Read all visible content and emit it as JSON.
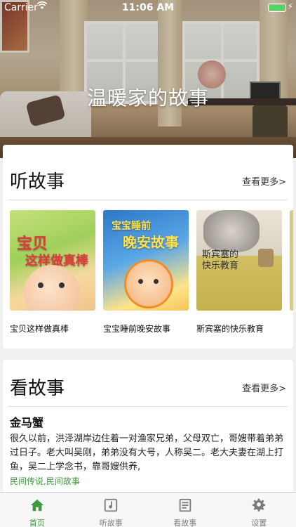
{
  "status_bar": {
    "carrier": "Carrier",
    "time": "11:06 AM"
  },
  "hero": {
    "title": "温暖家的故事"
  },
  "listen_section": {
    "title": "听故事",
    "more_label": "查看更多>",
    "books": [
      {
        "label": "宝贝这样做真棒",
        "cover_text": "宝贝 这样做真棒"
      },
      {
        "label": "宝宝睡前晚安故事",
        "cover_text": "宝宝睡前 晚安故事"
      },
      {
        "label": "斯宾塞的快乐教育",
        "cover_text": "斯宾塞的 快乐教育"
      }
    ]
  },
  "read_section": {
    "title": "看故事",
    "more_label": "查看更多>",
    "story": {
      "title": "金马蟹",
      "body": "很久以前，洪泽湖岸边住着一对渔家兄弟，父母双亡，哥嫂带着弟弟过日子。老大叫吴刚，弟弟没有大号，人称吴二。老大夫妻在湖上打鱼，吴二上学念书，靠哥嫂供养,",
      "tags": "民间传说,民间故事"
    }
  },
  "tab_bar": {
    "tabs": [
      {
        "label": "首页",
        "icon": "home-icon",
        "active": true
      },
      {
        "label": "听故事",
        "icon": "music-note-icon",
        "active": false
      },
      {
        "label": "看故事",
        "icon": "book-icon",
        "active": false
      },
      {
        "label": "设置",
        "icon": "gear-icon",
        "active": false
      }
    ]
  },
  "colors": {
    "accent": "#3c9a3a",
    "tab_inactive": "#7b7b7b",
    "battery": "#4cd964"
  }
}
